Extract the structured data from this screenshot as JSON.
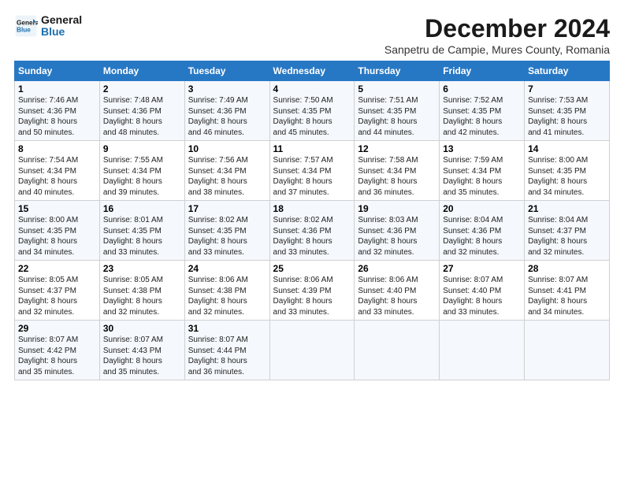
{
  "logo": {
    "line1": "General",
    "line2": "Blue"
  },
  "title": "December 2024",
  "subtitle": "Sanpetru de Campie, Mures County, Romania",
  "headers": [
    "Sunday",
    "Monday",
    "Tuesday",
    "Wednesday",
    "Thursday",
    "Friday",
    "Saturday"
  ],
  "weeks": [
    [
      {
        "day": "1",
        "sunrise": "7:46 AM",
        "sunset": "4:36 PM",
        "daylight": "8 hours and 50 minutes."
      },
      {
        "day": "2",
        "sunrise": "7:48 AM",
        "sunset": "4:36 PM",
        "daylight": "8 hours and 48 minutes."
      },
      {
        "day": "3",
        "sunrise": "7:49 AM",
        "sunset": "4:36 PM",
        "daylight": "8 hours and 46 minutes."
      },
      {
        "day": "4",
        "sunrise": "7:50 AM",
        "sunset": "4:35 PM",
        "daylight": "8 hours and 45 minutes."
      },
      {
        "day": "5",
        "sunrise": "7:51 AM",
        "sunset": "4:35 PM",
        "daylight": "8 hours and 44 minutes."
      },
      {
        "day": "6",
        "sunrise": "7:52 AM",
        "sunset": "4:35 PM",
        "daylight": "8 hours and 42 minutes."
      },
      {
        "day": "7",
        "sunrise": "7:53 AM",
        "sunset": "4:35 PM",
        "daylight": "8 hours and 41 minutes."
      }
    ],
    [
      {
        "day": "8",
        "sunrise": "7:54 AM",
        "sunset": "4:34 PM",
        "daylight": "8 hours and 40 minutes."
      },
      {
        "day": "9",
        "sunrise": "7:55 AM",
        "sunset": "4:34 PM",
        "daylight": "8 hours and 39 minutes."
      },
      {
        "day": "10",
        "sunrise": "7:56 AM",
        "sunset": "4:34 PM",
        "daylight": "8 hours and 38 minutes."
      },
      {
        "day": "11",
        "sunrise": "7:57 AM",
        "sunset": "4:34 PM",
        "daylight": "8 hours and 37 minutes."
      },
      {
        "day": "12",
        "sunrise": "7:58 AM",
        "sunset": "4:34 PM",
        "daylight": "8 hours and 36 minutes."
      },
      {
        "day": "13",
        "sunrise": "7:59 AM",
        "sunset": "4:34 PM",
        "daylight": "8 hours and 35 minutes."
      },
      {
        "day": "14",
        "sunrise": "8:00 AM",
        "sunset": "4:35 PM",
        "daylight": "8 hours and 34 minutes."
      }
    ],
    [
      {
        "day": "15",
        "sunrise": "8:00 AM",
        "sunset": "4:35 PM",
        "daylight": "8 hours and 34 minutes."
      },
      {
        "day": "16",
        "sunrise": "8:01 AM",
        "sunset": "4:35 PM",
        "daylight": "8 hours and 33 minutes."
      },
      {
        "day": "17",
        "sunrise": "8:02 AM",
        "sunset": "4:35 PM",
        "daylight": "8 hours and 33 minutes."
      },
      {
        "day": "18",
        "sunrise": "8:02 AM",
        "sunset": "4:36 PM",
        "daylight": "8 hours and 33 minutes."
      },
      {
        "day": "19",
        "sunrise": "8:03 AM",
        "sunset": "4:36 PM",
        "daylight": "8 hours and 32 minutes."
      },
      {
        "day": "20",
        "sunrise": "8:04 AM",
        "sunset": "4:36 PM",
        "daylight": "8 hours and 32 minutes."
      },
      {
        "day": "21",
        "sunrise": "8:04 AM",
        "sunset": "4:37 PM",
        "daylight": "8 hours and 32 minutes."
      }
    ],
    [
      {
        "day": "22",
        "sunrise": "8:05 AM",
        "sunset": "4:37 PM",
        "daylight": "8 hours and 32 minutes."
      },
      {
        "day": "23",
        "sunrise": "8:05 AM",
        "sunset": "4:38 PM",
        "daylight": "8 hours and 32 minutes."
      },
      {
        "day": "24",
        "sunrise": "8:06 AM",
        "sunset": "4:38 PM",
        "daylight": "8 hours and 32 minutes."
      },
      {
        "day": "25",
        "sunrise": "8:06 AM",
        "sunset": "4:39 PM",
        "daylight": "8 hours and 33 minutes."
      },
      {
        "day": "26",
        "sunrise": "8:06 AM",
        "sunset": "4:40 PM",
        "daylight": "8 hours and 33 minutes."
      },
      {
        "day": "27",
        "sunrise": "8:07 AM",
        "sunset": "4:40 PM",
        "daylight": "8 hours and 33 minutes."
      },
      {
        "day": "28",
        "sunrise": "8:07 AM",
        "sunset": "4:41 PM",
        "daylight": "8 hours and 34 minutes."
      }
    ],
    [
      {
        "day": "29",
        "sunrise": "8:07 AM",
        "sunset": "4:42 PM",
        "daylight": "8 hours and 35 minutes."
      },
      {
        "day": "30",
        "sunrise": "8:07 AM",
        "sunset": "4:43 PM",
        "daylight": "8 hours and 35 minutes."
      },
      {
        "day": "31",
        "sunrise": "8:07 AM",
        "sunset": "4:44 PM",
        "daylight": "8 hours and 36 minutes."
      },
      null,
      null,
      null,
      null
    ]
  ],
  "labels": {
    "sunrise": "Sunrise:",
    "sunset": "Sunset:",
    "daylight": "Daylight:"
  }
}
